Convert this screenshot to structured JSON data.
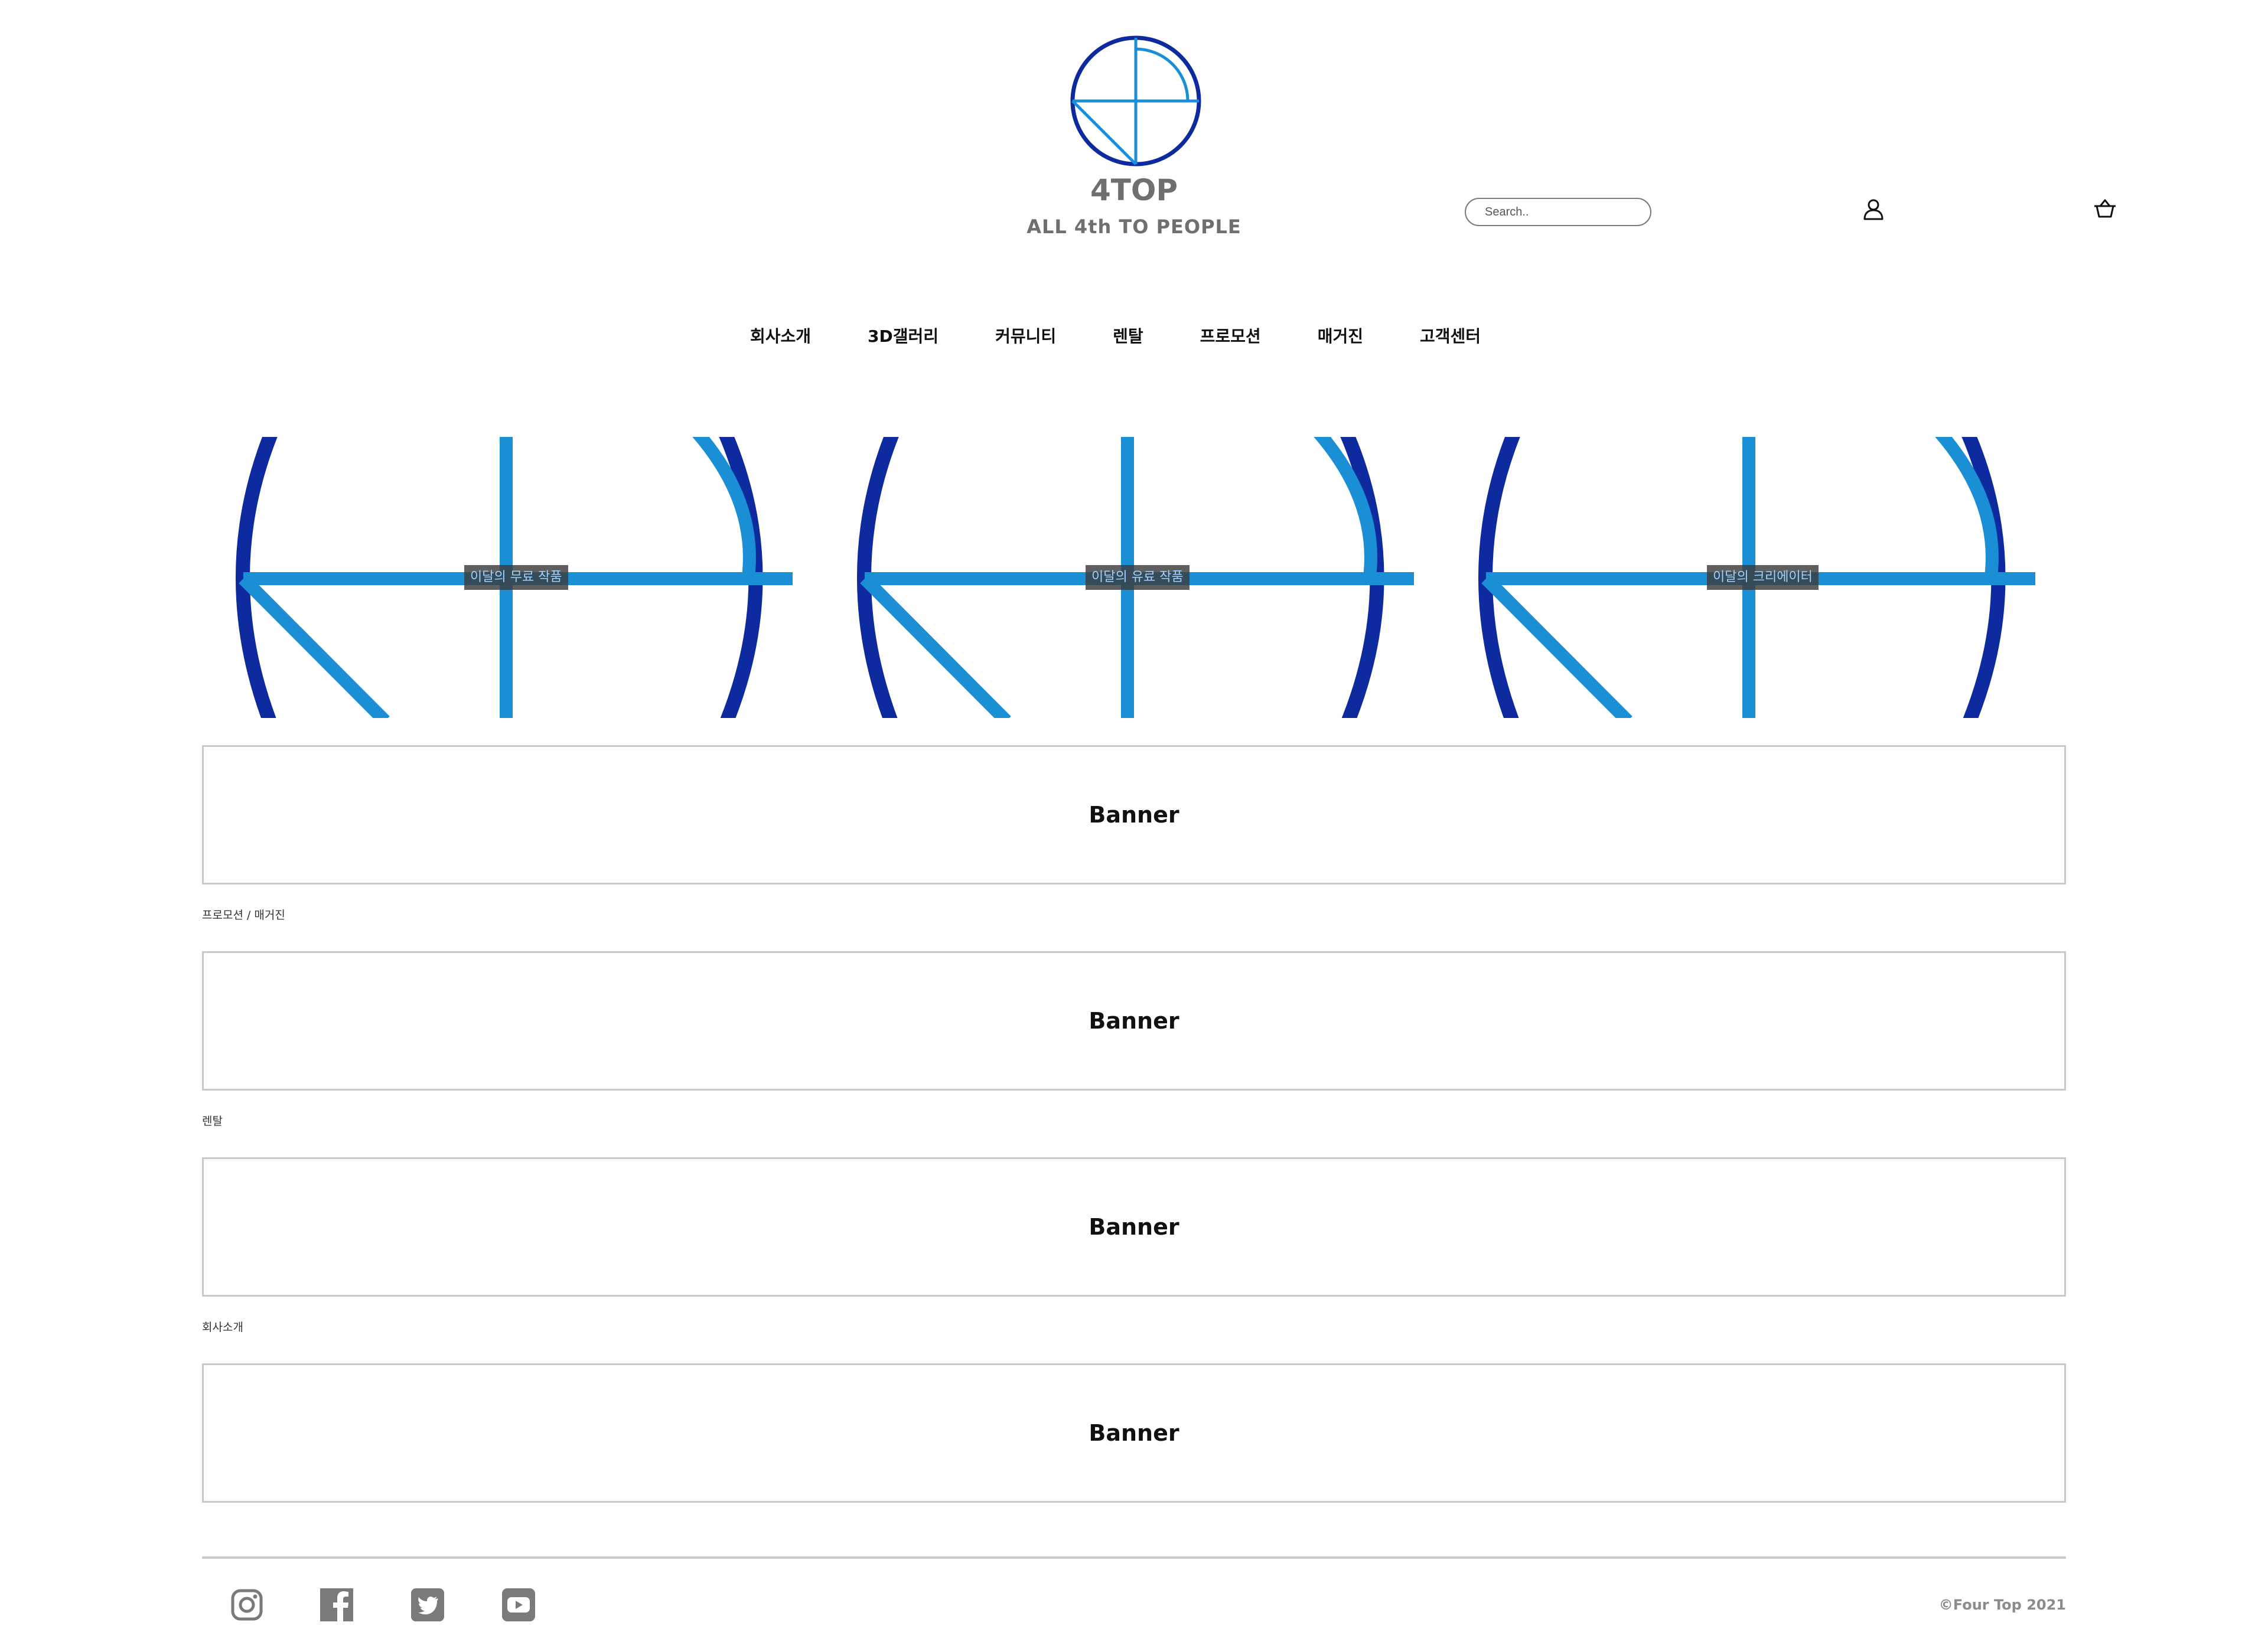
{
  "header": {
    "brand_name": "4TOP",
    "tagline": "ALL 4th TO PEOPLE",
    "search_placeholder": "Search..",
    "colors": {
      "logo_dark": "#0d2a9e",
      "logo_light": "#1a8fd6",
      "brand_text": "#6f6f6f"
    }
  },
  "nav": {
    "items": [
      "회사소개",
      "3D갤러리",
      "커뮤니티",
      "렌탈",
      "프로모션",
      "매거진",
      "고객센터"
    ]
  },
  "hero": {
    "slides": [
      {
        "label": "이달의 무료 작품"
      },
      {
        "label": "이달의 유료 작품"
      },
      {
        "label": "이달의 크리에이터"
      }
    ]
  },
  "banners": [
    {
      "label": "Banner"
    },
    {
      "label": "Banner",
      "section": "프로모션 / 매거진"
    },
    {
      "label": "Banner",
      "section": "렌탈"
    },
    {
      "label": "Banner",
      "section": "회사소개"
    }
  ],
  "footer": {
    "social": [
      "instagram-icon",
      "facebook-icon",
      "twitter-icon",
      "youtube-icon"
    ],
    "copyright": "©Four Top 2021"
  }
}
